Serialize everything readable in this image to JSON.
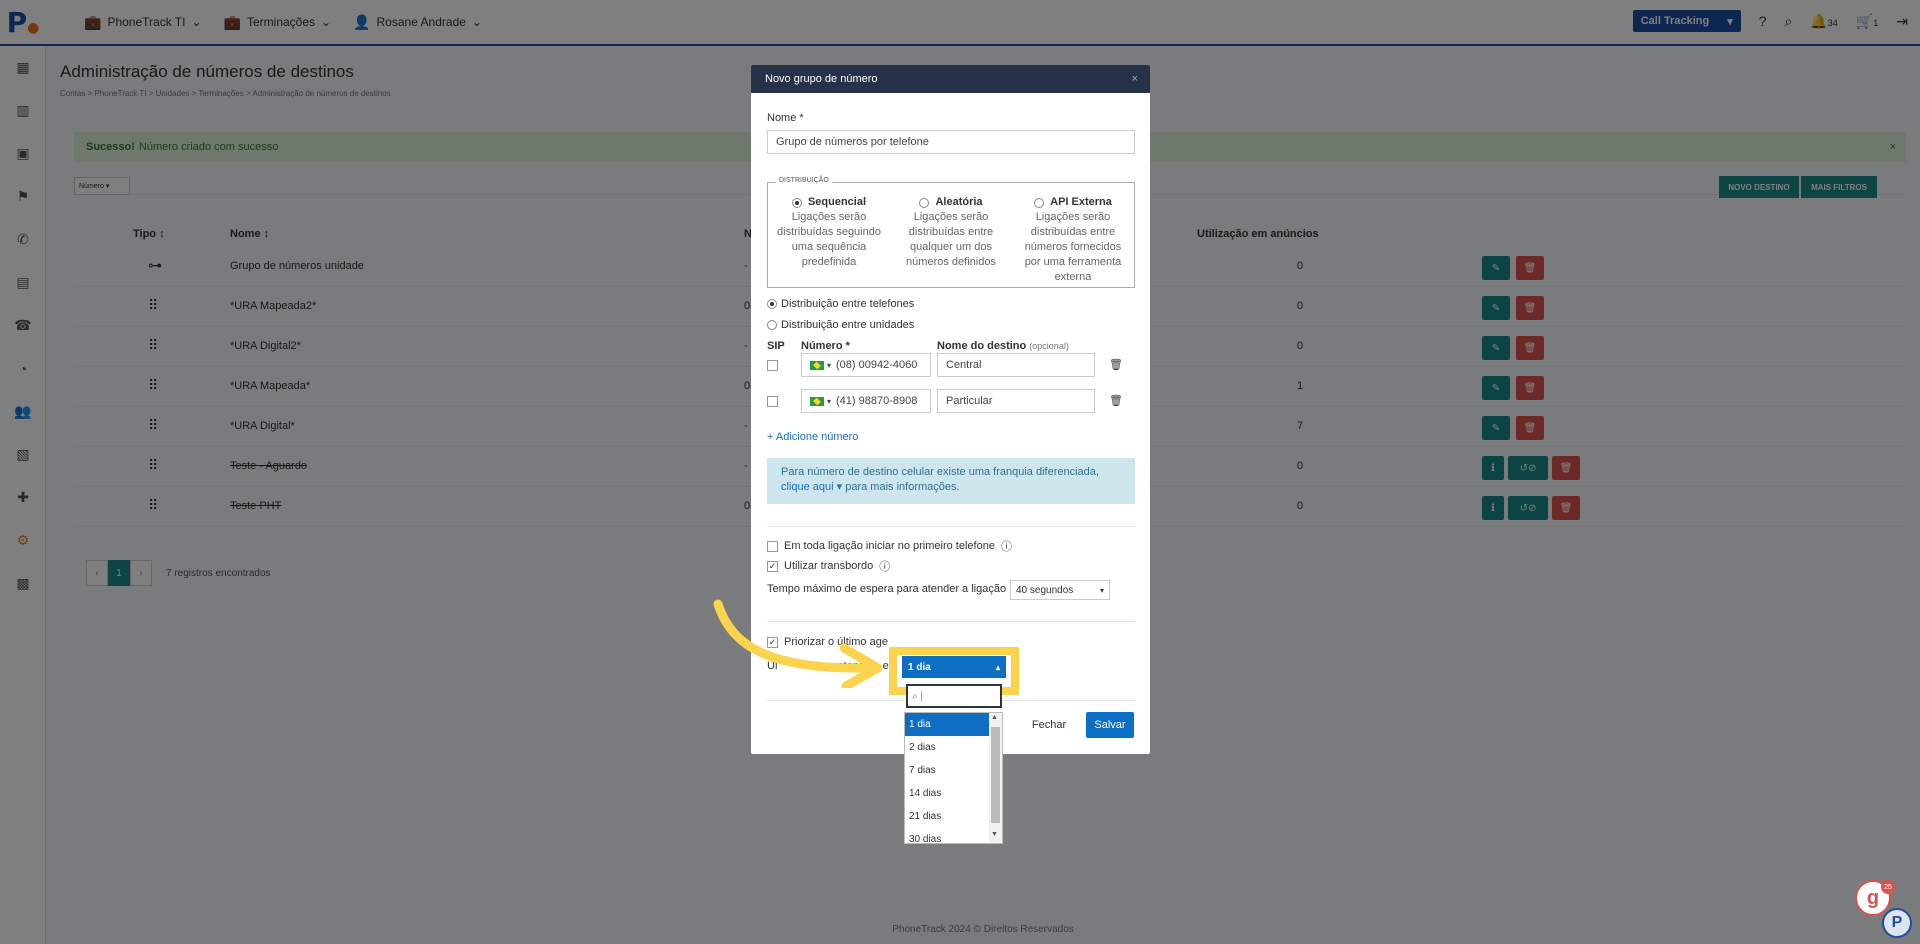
{
  "topbar": {
    "nav": [
      {
        "label": "PhoneTrack TI",
        "icon": "briefcase-icon"
      },
      {
        "label": "Terminações",
        "icon": "briefcase-icon"
      },
      {
        "label": "Rosane Andrade",
        "icon": "user-icon"
      }
    ],
    "product_select": "Call Tracking",
    "notifications_count": "34",
    "cart_count": "1"
  },
  "page": {
    "title": "Administração de números de destinos",
    "breadcrumb": "Contas  >  PhoneTrack TI  >  Unidades  >  Terminações  >  Administração de números de destinos",
    "alert_strong": "Sucesso!",
    "alert_text": "Número criado com sucesso",
    "filter_label": "Número",
    "btn_new": "NOVO DESTINO",
    "btn_filters": "MAIS FILTROS",
    "columns": {
      "tipo": "Tipo",
      "nome": "Nome",
      "n": "N",
      "uso": "Utilização em anúncios"
    },
    "rows": [
      {
        "name": "Grupo de números unidade",
        "col3": "-",
        "uso": "0"
      },
      {
        "name": "*URA Mapeada2*",
        "col3": "0",
        "uso": "0"
      },
      {
        "name": "*URA Digital2*",
        "col3": "-",
        "uso": "0"
      },
      {
        "name": "*URA Mapeada*",
        "col3": "0",
        "uso": "1"
      },
      {
        "name": "*URA Digital*",
        "col3": "-",
        "uso": "7"
      },
      {
        "name": "Teste - Aguardo",
        "col3": "-",
        "uso": "0"
      },
      {
        "name": "Teste PHT",
        "col3": "0",
        "uso": "0"
      }
    ],
    "pager_prev": "‹",
    "pager_current": "1",
    "pager_next": "›",
    "records": "7 registros encontrados",
    "footer": "PhoneTrack 2024 © Direitos Reservados"
  },
  "modal": {
    "title": "Novo grupo de número",
    "close": "×",
    "name_label": "Nome *",
    "name_value": "Grupo de números por telefone",
    "distribution_legend": "DISTRIBUIÇÃO",
    "options": [
      {
        "title": "Sequencial",
        "desc": "Ligações serão distribuídas seguindo uma sequência predefinida",
        "selected": true
      },
      {
        "title": "Aleatória",
        "desc": "Ligações serão distribuídas entre qualquer um dos números definidos",
        "selected": false
      },
      {
        "title": "API Externa",
        "desc": "Ligações serão distribuídas entre números fornecidos por uma ferramenta externa",
        "selected": false
      }
    ],
    "dist_phones": "Distribuição entre telefones",
    "dist_units": "Distribuição entre unidades",
    "col_sip": "SIP",
    "col_number": "Número *",
    "col_dest": "Nome do destino",
    "col_dest_opt": "(opcional)",
    "numbers": [
      {
        "number": "(08) 00942-4060",
        "dest": "Central"
      },
      {
        "number": "(41) 98870-8908",
        "dest": "Particular"
      }
    ],
    "add_number": "+ Adicione número",
    "info_text": "Para número de destino celular existe uma franquia diferenciada,",
    "info_link": "clique aqui",
    "info_text2": "para mais informações.",
    "opt_first_phone": "Em toda ligação iniciar no primeiro telefone",
    "opt_overflow": "Utilizar transbordo",
    "max_wait_label": "Tempo máximo de espera para atender a ligação",
    "max_wait_value": "40 segundos",
    "prio_label": "Priorizar o último age",
    "last_label": "Ul",
    "last_label2": "atendida e",
    "btn_close": "Fechar",
    "btn_save": "Salvar"
  },
  "dropdown": {
    "selected": "1 dia",
    "options": [
      "1 dia",
      "2 dias",
      "7 dias",
      "14 dias",
      "21 dias",
      "30 dias"
    ]
  },
  "widgets": {
    "help_badge": "25",
    "help_letter": "g",
    "chat_letter": "P"
  },
  "colors": {
    "brand": "#1b4fa0",
    "teal": "#1b8a8a",
    "danger": "#d9534f",
    "highlight": "#fcd34d"
  }
}
